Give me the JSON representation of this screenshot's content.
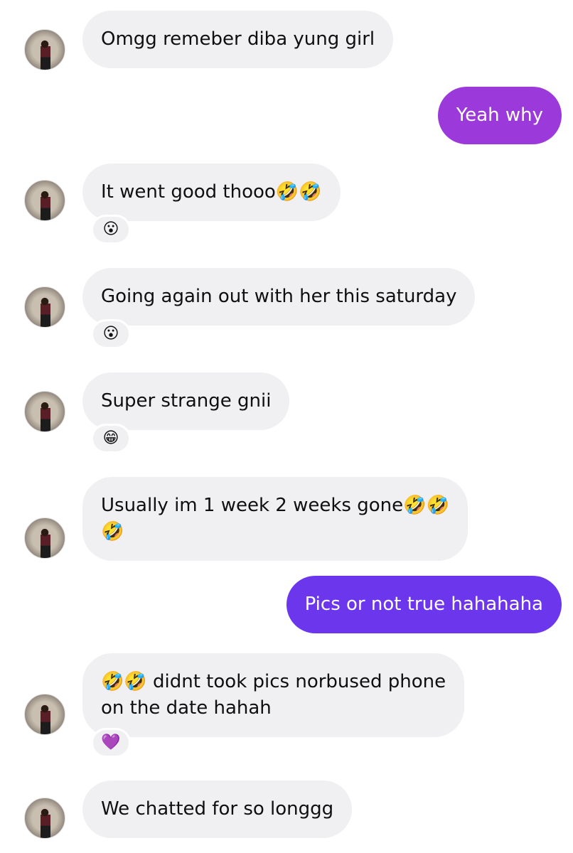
{
  "chat": {
    "messages": [
      {
        "sender": "them",
        "text": "Omgg remeber diba yung girl"
      },
      {
        "sender": "me",
        "text": "Yeah why"
      },
      {
        "sender": "them",
        "text": "It went good thooo🤣🤣",
        "reaction": "😮"
      },
      {
        "sender": "them",
        "text": "Going again out with her this saturday",
        "reaction": "😮"
      },
      {
        "sender": "them",
        "text": "Super strange gnii",
        "reaction": "😁"
      },
      {
        "sender": "them",
        "text_line1": "Usually im 1 week 2 weeks gone🤣🤣",
        "text_line2": "🤣"
      },
      {
        "sender": "me",
        "text": "Pics or not true hahahaha"
      },
      {
        "sender": "them",
        "text_line1": "🤣🤣 didnt took pics norbused phone",
        "text_line2": "on the date hahah",
        "reaction": "💜"
      },
      {
        "sender": "them",
        "text": "We chatted for so longgg"
      }
    ]
  },
  "colors": {
    "incoming_bubble": "#f0f0f2",
    "outgoing_bubble_1": "#9b39db",
    "outgoing_bubble_2": "#6c36ec"
  },
  "icons": {
    "avatar": "contact-avatar-photo"
  }
}
